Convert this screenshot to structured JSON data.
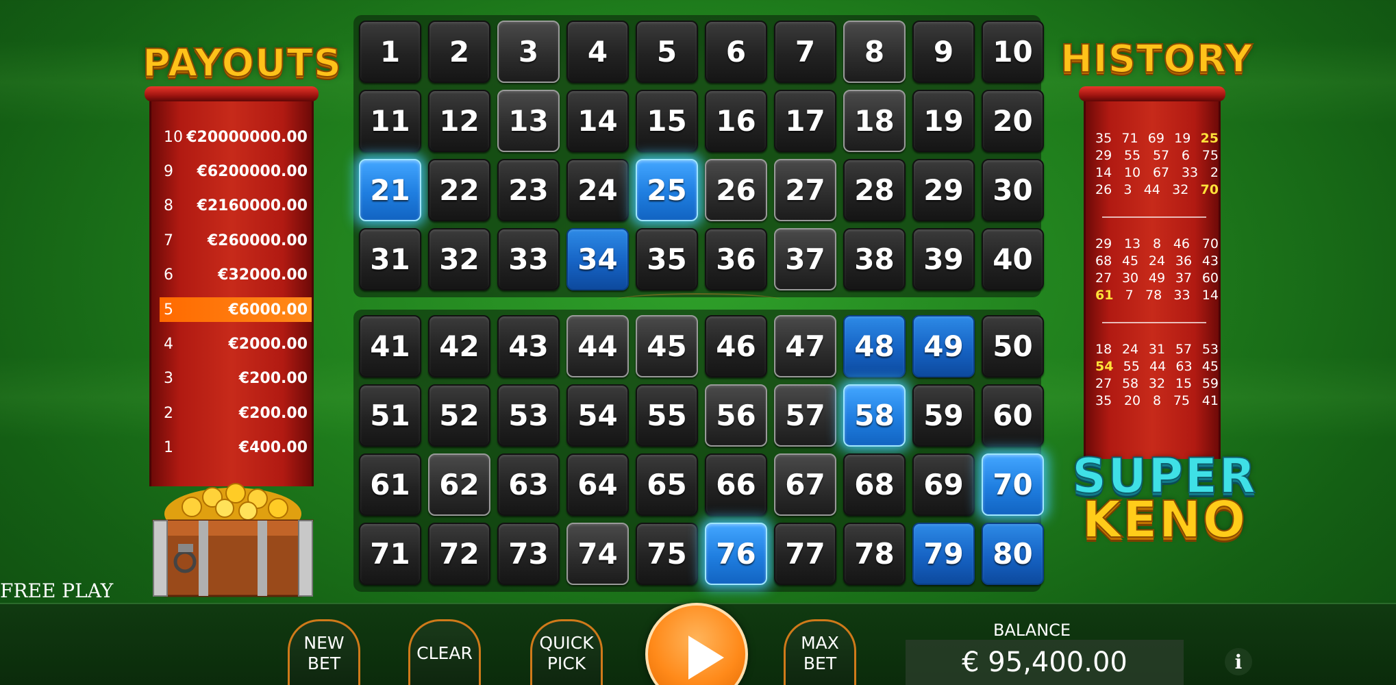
{
  "payouts": {
    "title": "PAYOUTS",
    "rows": [
      {
        "hits": "10",
        "amount": "€20000000.00",
        "active": false
      },
      {
        "hits": "9",
        "amount": "€6200000.00",
        "active": false
      },
      {
        "hits": "8",
        "amount": "€2160000.00",
        "active": false
      },
      {
        "hits": "7",
        "amount": "€260000.00",
        "active": false
      },
      {
        "hits": "6",
        "amount": "€32000.00",
        "active": false
      },
      {
        "hits": "5",
        "amount": "€6000.00",
        "active": true
      },
      {
        "hits": "4",
        "amount": "€2000.00",
        "active": false
      },
      {
        "hits": "3",
        "amount": "€200.00",
        "active": false
      },
      {
        "hits": "2",
        "amount": "€200.00",
        "active": false
      },
      {
        "hits": "1",
        "amount": "€400.00",
        "active": false
      }
    ]
  },
  "history": {
    "title": "HISTORY",
    "highlight_color": "#ffe23a",
    "draws": [
      [
        [
          "35",
          "71",
          "69",
          "19",
          "25"
        ],
        [
          "29",
          "55",
          "57",
          "6",
          "75"
        ],
        [
          "14",
          "10",
          "67",
          "33",
          "2"
        ],
        [
          "26",
          "3",
          "44",
          "32",
          "70"
        ]
      ],
      [
        [
          "29",
          "13",
          "8",
          "46",
          "70"
        ],
        [
          "68",
          "45",
          "24",
          "36",
          "43"
        ],
        [
          "27",
          "30",
          "49",
          "37",
          "60"
        ],
        [
          "61",
          "7",
          "78",
          "33",
          "14"
        ]
      ],
      [
        [
          "18",
          "24",
          "31",
          "57",
          "53"
        ],
        [
          "54",
          "55",
          "44",
          "63",
          "45"
        ],
        [
          "27",
          "58",
          "32",
          "15",
          "59"
        ],
        [
          "35",
          "20",
          "8",
          "75",
          "41"
        ]
      ]
    ],
    "highlighted": [
      [
        "25",
        "70"
      ],
      [
        "61"
      ],
      [
        "54"
      ]
    ]
  },
  "board": {
    "numbers": [
      "1",
      "2",
      "3",
      "4",
      "5",
      "6",
      "7",
      "8",
      "9",
      "10",
      "11",
      "12",
      "13",
      "14",
      "15",
      "16",
      "17",
      "18",
      "19",
      "20",
      "21",
      "22",
      "23",
      "24",
      "25",
      "26",
      "27",
      "28",
      "29",
      "30",
      "31",
      "32",
      "33",
      "34",
      "35",
      "36",
      "37",
      "38",
      "39",
      "40",
      "41",
      "42",
      "43",
      "44",
      "45",
      "46",
      "47",
      "48",
      "49",
      "50",
      "51",
      "52",
      "53",
      "54",
      "55",
      "56",
      "57",
      "58",
      "59",
      "60",
      "61",
      "62",
      "63",
      "64",
      "65",
      "66",
      "67",
      "68",
      "69",
      "70",
      "71",
      "72",
      "73",
      "74",
      "75",
      "76",
      "77",
      "78",
      "79",
      "80"
    ],
    "hits": [
      "21",
      "25",
      "58",
      "70",
      "76"
    ],
    "picked": [
      "34",
      "48",
      "49",
      "79",
      "80"
    ],
    "drawn": [
      "3",
      "8",
      "13",
      "18",
      "26",
      "27",
      "37",
      "44",
      "45",
      "47",
      "56",
      "57",
      "62",
      "67",
      "74"
    ]
  },
  "logo": {
    "line1": "SUPER",
    "line2": "KENO"
  },
  "status": {
    "free_play": "FREE PLAY"
  },
  "controls": {
    "new_bet": "NEW\nBET",
    "clear": "CLEAR",
    "quick_pick": "QUICK\nPICK",
    "max_bet": "MAX\nBET"
  },
  "balance": {
    "label": "BALANCE",
    "value": "€ 95,400.00"
  },
  "icons": {
    "play": "play-icon",
    "info": "info-icon",
    "chest": "treasure-chest-icon"
  }
}
